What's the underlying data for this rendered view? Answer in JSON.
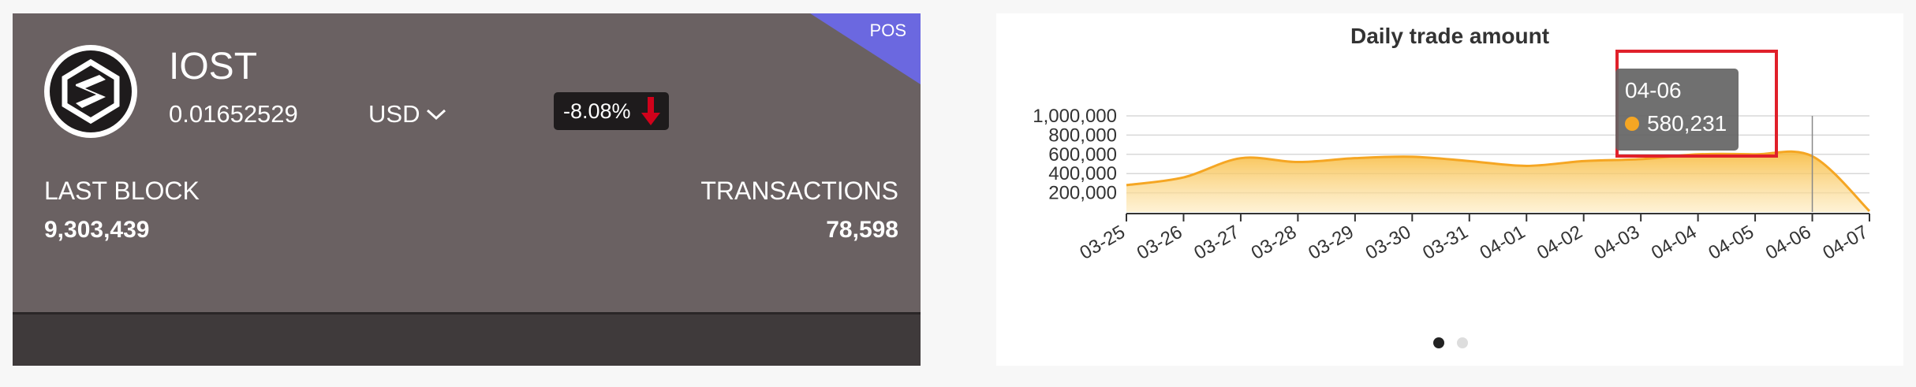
{
  "coin": {
    "badge": "POS",
    "name": "IOST",
    "price": "0.01652529",
    "currency": "USD",
    "change": "-8.08%",
    "last_block_label": "LAST BLOCK",
    "last_block_value": "9,303,439",
    "transactions_label": "TRANSACTIONS",
    "transactions_value": "78,598"
  },
  "chart_data": {
    "type": "area",
    "title": "Daily trade amount",
    "xlabel": "",
    "ylabel": "",
    "x": [
      "03-25",
      "03-26",
      "03-27",
      "03-28",
      "03-29",
      "03-30",
      "03-31",
      "04-01",
      "04-02",
      "04-03",
      "04-04",
      "04-05",
      "04-06",
      "04-07"
    ],
    "y_tick_labels": [
      "1,000,000",
      "800,000",
      "600,000",
      "400,000",
      "200,000"
    ],
    "y_ticks": [
      1000000,
      800000,
      600000,
      400000,
      200000
    ],
    "ylim": [
      0,
      1000000
    ],
    "series": [
      {
        "values": [
          280000,
          360000,
          560000,
          520000,
          560000,
          575000,
          530000,
          480000,
          530000,
          550000,
          600000,
          600000,
          580231,
          10000
        ]
      }
    ],
    "color": "#f5a623",
    "grid": true,
    "tooltip": {
      "date": "04-06",
      "value": "580,231"
    }
  },
  "pager": {
    "count": 2,
    "active": 0
  }
}
